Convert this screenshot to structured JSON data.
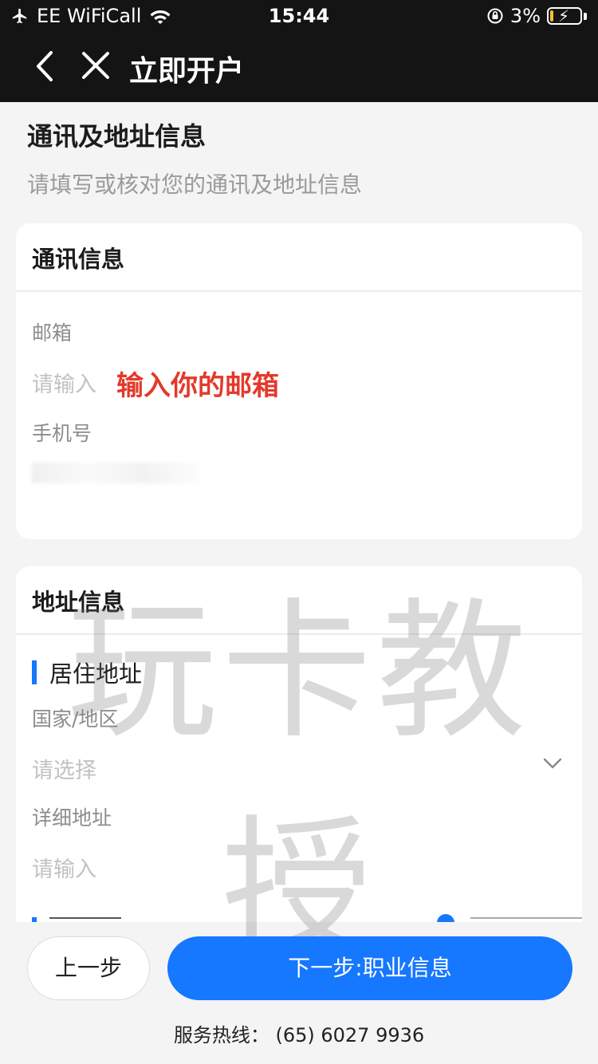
{
  "status_bar": {
    "carrier": "EE WiFiCall",
    "time": "15:44",
    "battery": "3%",
    "icons": [
      "airplane-icon",
      "wifi-icon",
      "rotation-lock-icon",
      "battery-charging-icon"
    ],
    "battery_level": 0.03
  },
  "nav": {
    "title": "立即开户",
    "icons": [
      "back-chevron-icon",
      "close-icon"
    ]
  },
  "page": {
    "heading": "通讯及地址信息",
    "subheading": "请填写或核对您的通讯及地址信息"
  },
  "contact_card": {
    "title": "通讯信息",
    "email_label": "邮箱",
    "email_placeholder": "请输入",
    "email_annotation": "输入你的邮箱",
    "phone_label": "手机号"
  },
  "address_card": {
    "title": "地址信息",
    "section_title": "居住地址",
    "country_label": "国家/地区",
    "country_placeholder": "请选择",
    "detail_label": "详细地址",
    "detail_placeholder": "请输入"
  },
  "watermark": "玩卡教授",
  "footer": {
    "prev_button": "上一步",
    "next_button": "下一步:职业信息",
    "hotline": "服务热线： (65) 6027 9936"
  },
  "colors": {
    "accent": "#1677ff",
    "annotation": "#e4392b",
    "nav_bg": "#141414",
    "page_bg": "#f4f4f4"
  }
}
